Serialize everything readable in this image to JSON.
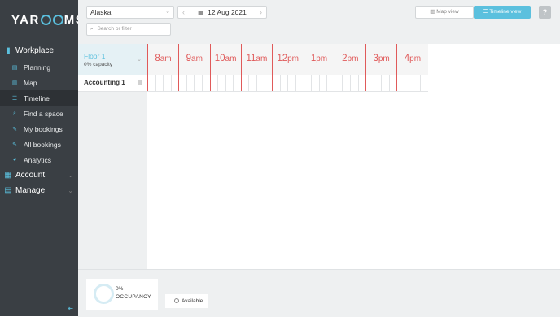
{
  "app": {
    "logo_text_left": "YAR",
    "logo_text_right": "MS"
  },
  "sidebar": {
    "groups": [
      {
        "label": "Workplace",
        "icon": "building-icon",
        "items": [
          {
            "label": "Planning",
            "icon": "planning-icon"
          },
          {
            "label": "Map",
            "icon": "map-icon"
          },
          {
            "label": "Timeline",
            "icon": "timeline-icon",
            "active": true
          },
          {
            "label": "Find a space",
            "icon": "search-icon"
          },
          {
            "label": "My bookings",
            "icon": "bookings-icon"
          },
          {
            "label": "All bookings",
            "icon": "all-bookings-icon"
          },
          {
            "label": "Analytics",
            "icon": "analytics-icon"
          }
        ]
      },
      {
        "label": "Account",
        "icon": "account-icon"
      },
      {
        "label": "Manage",
        "icon": "manage-icon"
      }
    ]
  },
  "topbar": {
    "location_value": "Alaska",
    "search_placeholder": "Search or filter",
    "date": "12 Aug 2021",
    "map_view_label": "Map view",
    "timeline_view_label": "Timeline view",
    "help_label": "?"
  },
  "timeline": {
    "floor": {
      "name": "Floor 1",
      "capacity": "0% capacity"
    },
    "rooms": [
      {
        "name": "Accounting 1"
      }
    ],
    "hours": [
      {
        "num": "8",
        "suffix": "am"
      },
      {
        "num": "9",
        "suffix": "am"
      },
      {
        "num": "10",
        "suffix": "am"
      },
      {
        "num": "11",
        "suffix": "am"
      },
      {
        "num": "12",
        "suffix": "pm"
      },
      {
        "num": "1",
        "suffix": "pm"
      },
      {
        "num": "2",
        "suffix": "pm"
      },
      {
        "num": "3",
        "suffix": "pm"
      },
      {
        "num": "4",
        "suffix": "pm"
      }
    ]
  },
  "footer": {
    "occupancy_value": "0%",
    "occupancy_label": "OCCUPANCY",
    "legend_available": "Available"
  },
  "colors": {
    "accent": "#5bc0de",
    "hour_line": "#e05a5a",
    "sidebar_bg": "#3a3f44"
  }
}
